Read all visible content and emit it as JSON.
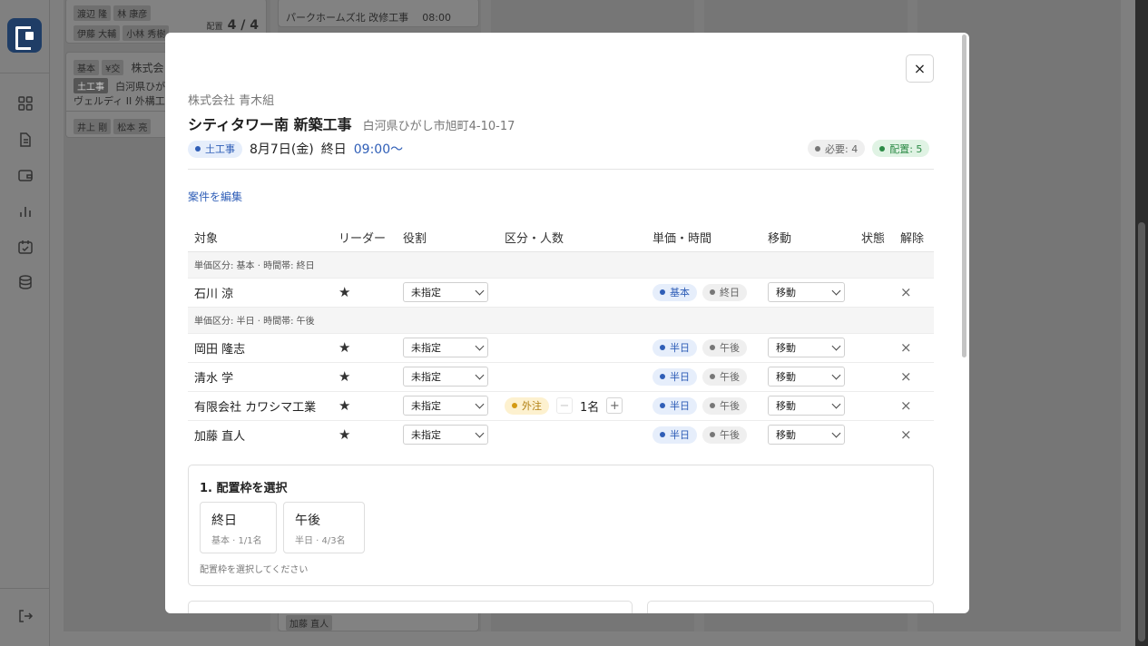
{
  "background": {
    "cards": {
      "card1_names_row1": [
        "渡辺 隆",
        "林 康彦"
      ],
      "card1_names_row2": [
        "伊藤 大輔",
        "小林 秀樹"
      ],
      "card1_assign_label": "配置",
      "card1_assign_value": "4 / 4",
      "card2_badges": [
        "基本",
        "¥交"
      ],
      "card2_company": "株式会",
      "card2_category": "土工事",
      "card2_location": "白河県ひが",
      "card2_site": "ヴェルディ II 外構工",
      "card2_names": [
        "井上 剛",
        "松本 亮"
      ],
      "col2_site": "パークホームズ北 改修工事",
      "col2_time": "08:00",
      "col2_bottom_name": "加藤 直人"
    }
  },
  "modal": {
    "close_label": "×",
    "company": "株式会社 青木組",
    "title": "シティタワー南 新築工事",
    "address": "白河県ひがし市旭町4-10-17",
    "category": "土工事",
    "date": "8月7日(金)",
    "duration": "終日",
    "time": "09:00〜",
    "required": "必要: 4",
    "assigned": "配置: 5",
    "edit_link": "案件を編集",
    "table": {
      "headers": {
        "target": "対象",
        "leader": "リーダー",
        "role": "役割",
        "division": "区分・人数",
        "unit": "単価・時間",
        "move": "移動",
        "status": "状態",
        "remove": "解除"
      },
      "groups": [
        {
          "label": "単価区分: 基本 · 時間帯: 終日",
          "rows": [
            {
              "name": "石川 涼",
              "leader": "★",
              "role": "未指定",
              "unit": "基本",
              "time": "終日",
              "move": "移動",
              "remove": "×"
            }
          ]
        },
        {
          "label": "単価区分: 半日 · 時間帯: 午後",
          "rows": [
            {
              "name": "岡田 隆志",
              "leader": "★",
              "role": "未指定",
              "unit": "半日",
              "time": "午後",
              "move": "移動",
              "remove": "×"
            },
            {
              "name": "清水 学",
              "leader": "★",
              "role": "未指定",
              "unit": "半日",
              "time": "午後",
              "move": "移動",
              "remove": "×"
            },
            {
              "name": "有限会社 カワシマ工業",
              "leader": "★",
              "role": "未指定",
              "division": "外注",
              "minus": "−",
              "count": "1名",
              "plus": "+",
              "unit": "半日",
              "time": "午後",
              "move": "移動",
              "remove": "×"
            },
            {
              "name": "加藤 直人",
              "leader": "★",
              "role": "未指定",
              "unit": "半日",
              "time": "午後",
              "move": "移動",
              "remove": "×"
            }
          ]
        }
      ]
    },
    "slot_panel": {
      "title": "1. 配置枠を選択",
      "options": [
        {
          "name": "終日",
          "sub": "基本 · 1/1名"
        },
        {
          "name": "午後",
          "sub": "半日 · 4/3名"
        }
      ],
      "hint": "配置枠を選択してください"
    }
  },
  "colors": {
    "accent_blue": "#2f5eb7",
    "success_green": "#2b8a45",
    "warning_yellow": "#d49a12",
    "overlay": "#7f7f7f"
  }
}
